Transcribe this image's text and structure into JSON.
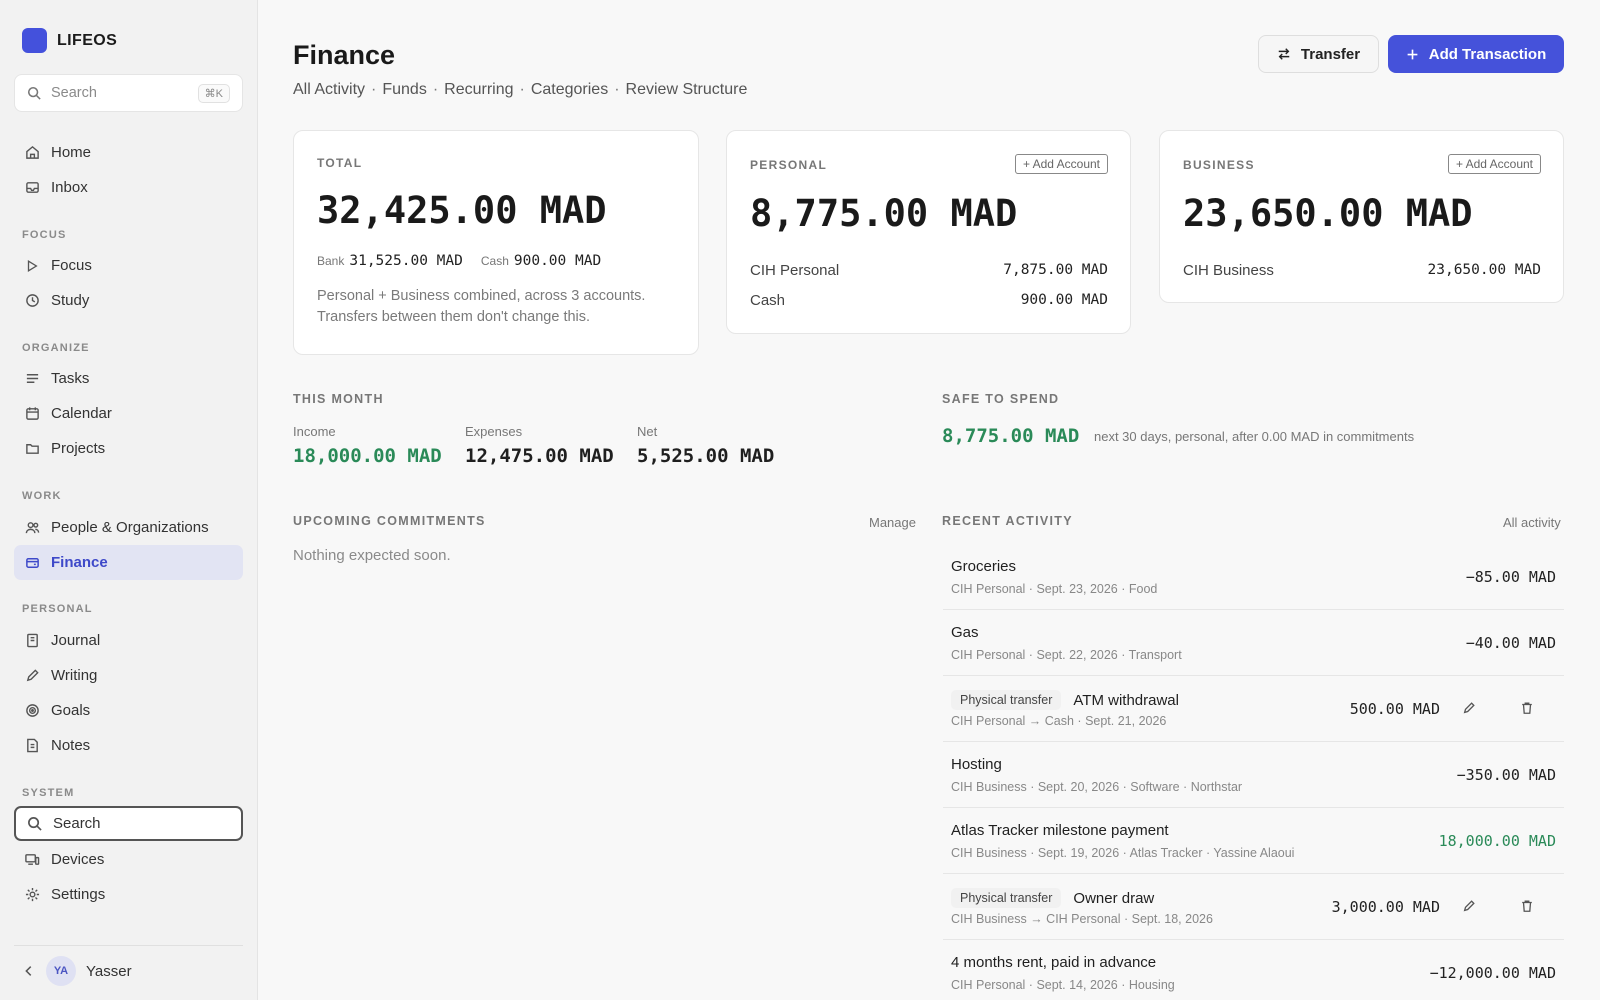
{
  "app": {
    "name": "LIFEOS"
  },
  "sidebar": {
    "search_placeholder": "Search",
    "search_shortcut": "⌘K",
    "top_items": [
      {
        "label": "Home",
        "icon": "home-icon"
      },
      {
        "label": "Inbox",
        "icon": "inbox-icon"
      }
    ],
    "sections": {
      "focus": "FOCUS",
      "organize": "ORGANIZE",
      "work": "WORK",
      "personal": "PERSONAL",
      "system": "SYSTEM"
    },
    "focus_items": [
      {
        "label": "Focus"
      },
      {
        "label": "Study"
      }
    ],
    "organize_items": [
      {
        "label": "Tasks"
      },
      {
        "label": "Calendar"
      },
      {
        "label": "Projects"
      }
    ],
    "work_items": [
      {
        "label": "People & Organizations"
      },
      {
        "label": "Finance",
        "active": true
      }
    ],
    "personal_items": [
      {
        "label": "Journal"
      },
      {
        "label": "Writing"
      },
      {
        "label": "Goals"
      },
      {
        "label": "Notes"
      }
    ],
    "system_items": [
      {
        "label": "Search",
        "outlined": true
      },
      {
        "label": "Devices"
      },
      {
        "label": "Settings"
      }
    ],
    "user": {
      "initials": "YA",
      "name": "Yasser"
    }
  },
  "header": {
    "title": "Finance",
    "subnav": [
      "All Activity",
      "Funds",
      "Recurring",
      "Categories",
      "Review Structure"
    ],
    "transfer_label": "Transfer",
    "add_label": "Add Transaction"
  },
  "cards": {
    "total": {
      "label": "TOTAL",
      "amount": "32,425.00 MAD",
      "bank_label": "Bank",
      "bank_value": "31,525.00 MAD",
      "cash_label": "Cash",
      "cash_value": "900.00 MAD",
      "note": "Personal + Business combined, across 3 accounts. Transfers between them don't change this."
    },
    "personal": {
      "label": "PERSONAL",
      "add_label": "+ Add Account",
      "amount": "8,775.00 MAD",
      "accounts": [
        {
          "name": "CIH Personal",
          "value": "7,875.00 MAD"
        },
        {
          "name": "Cash",
          "value": "900.00 MAD"
        }
      ]
    },
    "business": {
      "label": "BUSINESS",
      "add_label": "+ Add Account",
      "amount": "23,650.00 MAD",
      "accounts": [
        {
          "name": "CIH Business",
          "value": "23,650.00 MAD"
        }
      ]
    }
  },
  "this_month": {
    "label": "THIS MONTH",
    "income_label": "Income",
    "income": "18,000.00 MAD",
    "expenses_label": "Expenses",
    "expenses": "12,475.00 MAD",
    "net_label": "Net",
    "net": "5,525.00 MAD"
  },
  "safe_to_spend": {
    "label": "SAFE TO SPEND",
    "amount": "8,775.00 MAD",
    "note": "next 30 days, personal, after 0.00 MAD in commitments"
  },
  "commitments": {
    "label": "UPCOMING COMMITMENTS",
    "manage_label": "Manage",
    "empty_text": "Nothing expected soon."
  },
  "activity": {
    "label": "RECENT ACTIVITY",
    "all_label": "All activity",
    "items": [
      {
        "title": "Groceries",
        "meta": "CIH Personal · Sept. 23, 2026 · Food",
        "amount": "−85.00 MAD"
      },
      {
        "title": "Gas",
        "meta": "CIH Personal · Sept. 22, 2026 · Transport",
        "amount": "−40.00 MAD"
      },
      {
        "tag": "Physical transfer",
        "title": "ATM withdrawal",
        "meta": "CIH Personal → Cash · Sept. 21, 2026",
        "amount": "500.00 MAD",
        "transfer": true
      },
      {
        "title": "Hosting",
        "meta": "CIH Business · Sept. 20, 2026 · Software · Northstar",
        "amount": "−350.00 MAD"
      },
      {
        "title": "Atlas Tracker milestone payment",
        "meta": "CIH Business · Sept. 19, 2026 · Atlas Tracker · Yassine Alaoui",
        "amount": "18,000.00 MAD",
        "income": true
      },
      {
        "tag": "Physical transfer",
        "title": "Owner draw",
        "meta": "CIH Business → CIH Personal · Sept. 18, 2026",
        "amount": "3,000.00 MAD",
        "transfer": true
      },
      {
        "title": "4 months rent, paid in advance",
        "meta": "CIH Personal · Sept. 14, 2026 · Housing",
        "amount": "−12,000.00 MAD"
      }
    ]
  },
  "colors": {
    "accent": "#4552da",
    "income": "#2a8a58",
    "active_nav_bg": "#e2e4f3"
  }
}
